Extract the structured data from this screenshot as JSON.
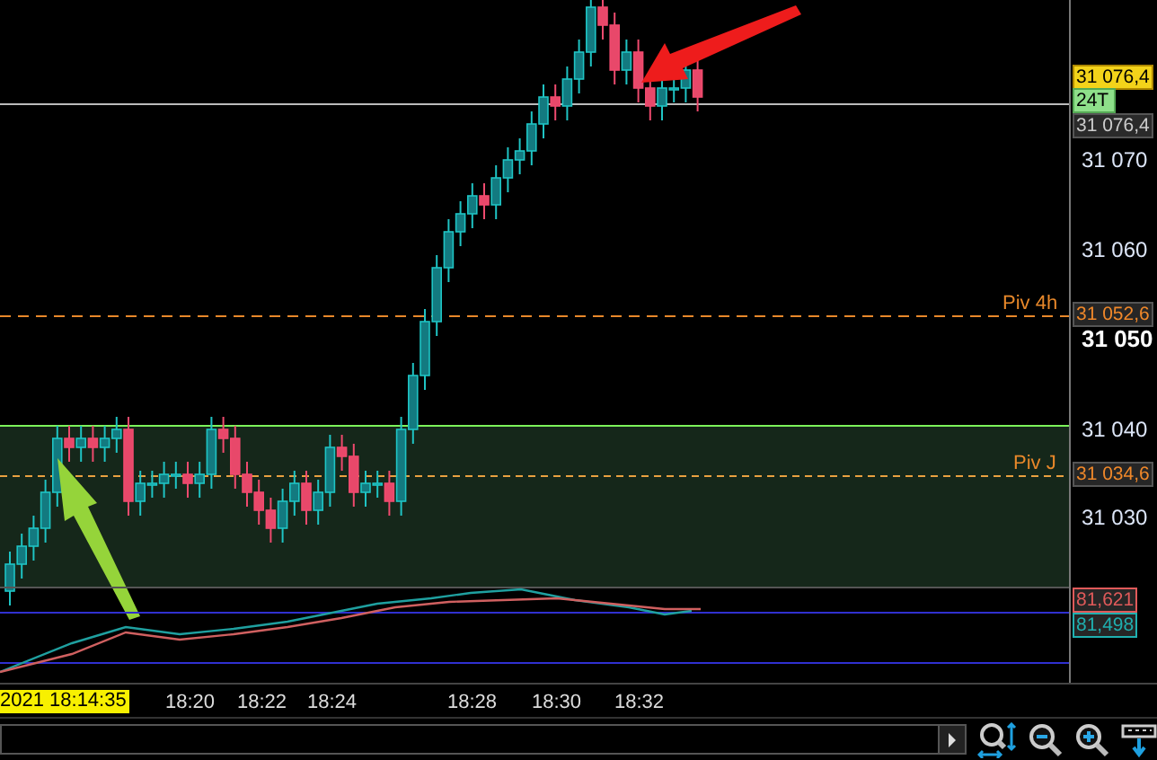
{
  "price_axis": {
    "ticks": [
      {
        "label": "31 070",
        "major": false
      },
      {
        "label": "31 060",
        "major": false
      },
      {
        "label": "31 050",
        "major": true
      },
      {
        "label": "31 040",
        "major": false
      },
      {
        "label": "31 030",
        "major": false
      }
    ]
  },
  "price_tags": [
    {
      "text": "31 076,4",
      "kind": "last"
    },
    {
      "text": "24T",
      "kind": "timer"
    },
    {
      "text": "31 076,4",
      "kind": "bid"
    },
    {
      "text": "31 052,6",
      "kind": "pivot"
    },
    {
      "text": "31 034,6",
      "kind": "pivot"
    },
    {
      "text": "81,621",
      "kind": "indicator",
      "color": "#e05a5a"
    },
    {
      "text": "81,498",
      "kind": "indicator",
      "color": "#1fb0b0"
    }
  ],
  "pivot_labels": [
    "Piv 4h",
    "Piv J"
  ],
  "time_axis": {
    "cursor_time": "2021 18:14:35",
    "ticks": [
      "18:20",
      "18:22",
      "18:24",
      "18:28",
      "18:30",
      "18:32"
    ]
  }
}
